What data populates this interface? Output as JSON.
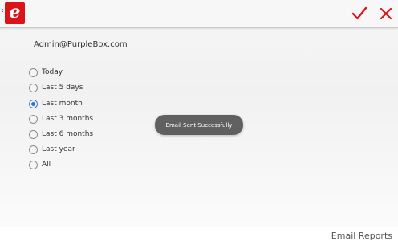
{
  "header": {
    "logo_letter": "e",
    "back_glyph": "‹",
    "confirm_icon": "checkmark-icon",
    "close_icon": "close-icon",
    "accent_color": "#d9141b"
  },
  "form": {
    "email_value": "Admin@PurpleBox.com",
    "range_options": [
      {
        "label": "Today",
        "selected": false
      },
      {
        "label": "Last 5 days",
        "selected": false
      },
      {
        "label": "Last month",
        "selected": true
      },
      {
        "label": "Last 3 months",
        "selected": false
      },
      {
        "label": "Last 6 months",
        "selected": false
      },
      {
        "label": "Last year",
        "selected": false
      },
      {
        "label": "All",
        "selected": false
      }
    ]
  },
  "toast": {
    "message": "Email Sent Successfully"
  },
  "footer": {
    "title": "Email Reports"
  }
}
